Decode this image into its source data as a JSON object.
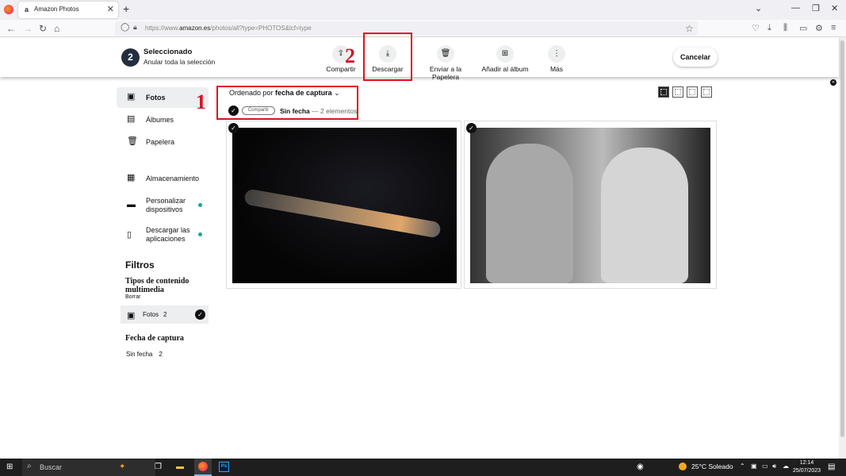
{
  "browser": {
    "tab_title": "Amazon Photos",
    "tab_favicon": "a",
    "new_tab": "+",
    "url_prefix": "https://www.",
    "url_domain": "amazon.es",
    "url_path": "/photos/all?type=PHOTOS&lcf=type"
  },
  "selection": {
    "count": "2",
    "title": "Seleccionado",
    "subtitle": "Anular toda la selección",
    "actions": [
      {
        "label": "Compartir",
        "icon": "share-icon"
      },
      {
        "label": "Descargar",
        "icon": "download-icon"
      },
      {
        "label": "Enviar a la Papelera",
        "icon": "trash-icon"
      },
      {
        "label": "Añadir al álbum",
        "icon": "add-album-icon"
      },
      {
        "label": "Más",
        "icon": "more-icon"
      }
    ],
    "cancel": "Cancelar"
  },
  "sidebar": {
    "items": [
      {
        "label": "Fotos",
        "icon": "photos-icon"
      },
      {
        "label": "Álbumes",
        "icon": "albums-icon"
      },
      {
        "label": "Papelera",
        "icon": "trash-icon"
      },
      {
        "label": "Almacenamiento",
        "icon": "storage-icon"
      },
      {
        "label": "Personalizar dispositivos",
        "icon": "device-icon"
      },
      {
        "label": "Descargar las aplicaciones",
        "icon": "phone-icon"
      }
    ],
    "filters_title": "Filtros",
    "media_types_title": "Tipos de contenido multimedia",
    "clear": "Borrar",
    "media_filter": {
      "label": "Fotos",
      "count": "2"
    },
    "date_title": "Fecha de captura",
    "date_filter": {
      "label": "Sin fecha",
      "count": "2"
    }
  },
  "content": {
    "sort_prefix": "Ordenado por ",
    "sort_value": "fecha de captura",
    "share_pill": "Compartir",
    "group_title": "Sin fecha",
    "group_count": " — 2 elementos"
  },
  "annotations": {
    "one": "1",
    "two": "2"
  },
  "taskbar": {
    "search_placeholder": "Buscar",
    "weather": "25°C Soleado",
    "time": "12:14",
    "date": "25/07/2023",
    "ps_label": "Ps"
  },
  "colors": {
    "accent_dot": "#19a69a",
    "highlight": "#e0101c",
    "dark": "#232f3e"
  }
}
